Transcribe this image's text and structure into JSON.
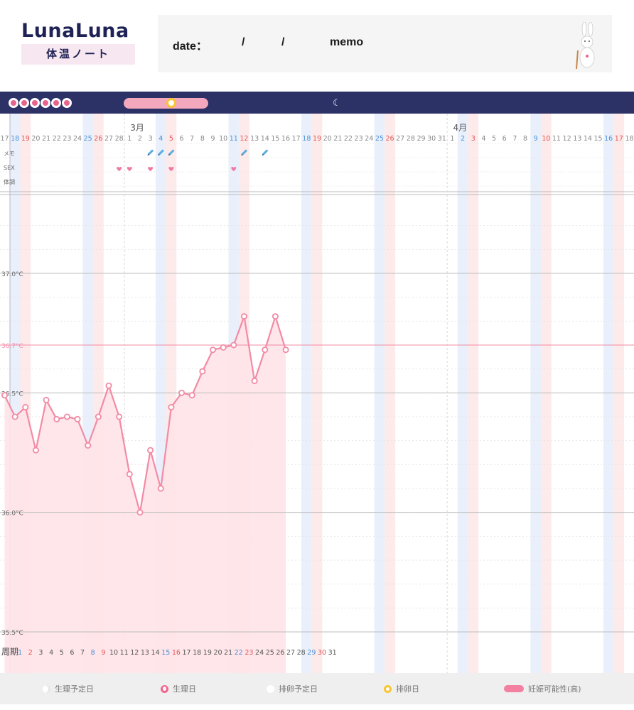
{
  "header": {
    "logo_main": "LunaLuna",
    "logo_sub": "体温ノート",
    "date_label": "date：",
    "date_sep1": "/",
    "date_sep2": "/",
    "memo_label": "memo"
  },
  "colors": {
    "navy": "#2c3166",
    "pink": "#f28ba5",
    "pink_fill": "#ffe3e8",
    "blue_col": "#e9f0fb",
    "red_col": "#fdeaea",
    "sat_text": "#4b90d8",
    "sun_text": "#e05555",
    "baseline": "#f28ba5"
  },
  "legend": {
    "planned_period": "生理予定日",
    "period": "生理日",
    "planned_ovulation": "排卵予定日",
    "ovulation": "排卵日",
    "fertility_high": "妊娠可能性(高)"
  },
  "chart_data": {
    "type": "line",
    "row_labels": [
      "メモ",
      "SEX",
      "体調"
    ],
    "month_labels": [
      {
        "label": "3月",
        "index": 13
      },
      {
        "label": "4月",
        "index": 44
      }
    ],
    "dates": [
      "17",
      "18",
      "19",
      "20",
      "21",
      "22",
      "23",
      "24",
      "25",
      "26",
      "27",
      "28",
      "1",
      "2",
      "3",
      "4",
      "5",
      "6",
      "7",
      "8",
      "9",
      "10",
      "11",
      "12",
      "13",
      "14",
      "15",
      "16",
      "17",
      "18",
      "19",
      "20",
      "21",
      "22",
      "23",
      "24",
      "25",
      "26",
      "27",
      "28",
      "29",
      "30",
      "31",
      "1",
      "2",
      "3",
      "4",
      "5",
      "6",
      "7",
      "8",
      "9",
      "10",
      "11",
      "12",
      "13",
      "14",
      "15",
      "16",
      "17",
      "18"
    ],
    "saturday_indices": [
      1,
      8,
      15,
      22,
      29,
      36,
      44,
      51,
      58
    ],
    "sunday_indices": [
      2,
      9,
      16,
      23,
      30,
      37,
      45,
      52,
      59
    ],
    "cycle_label": "周期",
    "cycle_days": [
      "1",
      "2",
      "3",
      "4",
      "5",
      "6",
      "7",
      "8",
      "9",
      "10",
      "11",
      "12",
      "13",
      "14",
      "15",
      "16",
      "17",
      "18",
      "19",
      "20",
      "21",
      "22",
      "23",
      "24",
      "25",
      "26",
      "27",
      "28",
      "29",
      "30",
      "31"
    ],
    "temperature_series": {
      "name": "",
      "start_index": 0,
      "values": [
        36.49,
        36.4,
        36.44,
        36.26,
        36.47,
        36.39,
        36.4,
        36.39,
        36.28,
        36.4,
        36.53,
        36.4,
        36.16,
        36.0,
        36.26,
        36.1,
        36.44,
        36.5,
        36.49,
        36.59,
        36.68,
        36.69,
        36.7,
        36.82,
        36.55,
        36.68,
        36.82,
        36.68
      ]
    },
    "memo_marks": [
      14,
      15,
      16,
      23,
      25
    ],
    "sex_marks": [
      11,
      12,
      14,
      16,
      22
    ],
    "ylim": [
      35.5,
      37.2
    ],
    "y_ticks": [
      "37.0°C",
      "36.7°C",
      "36.5°C",
      "36.0°C",
      "35.5°C"
    ],
    "y_tick_values": [
      37.0,
      36.7,
      36.5,
      36.0,
      35.5
    ],
    "baseline": 36.7
  }
}
